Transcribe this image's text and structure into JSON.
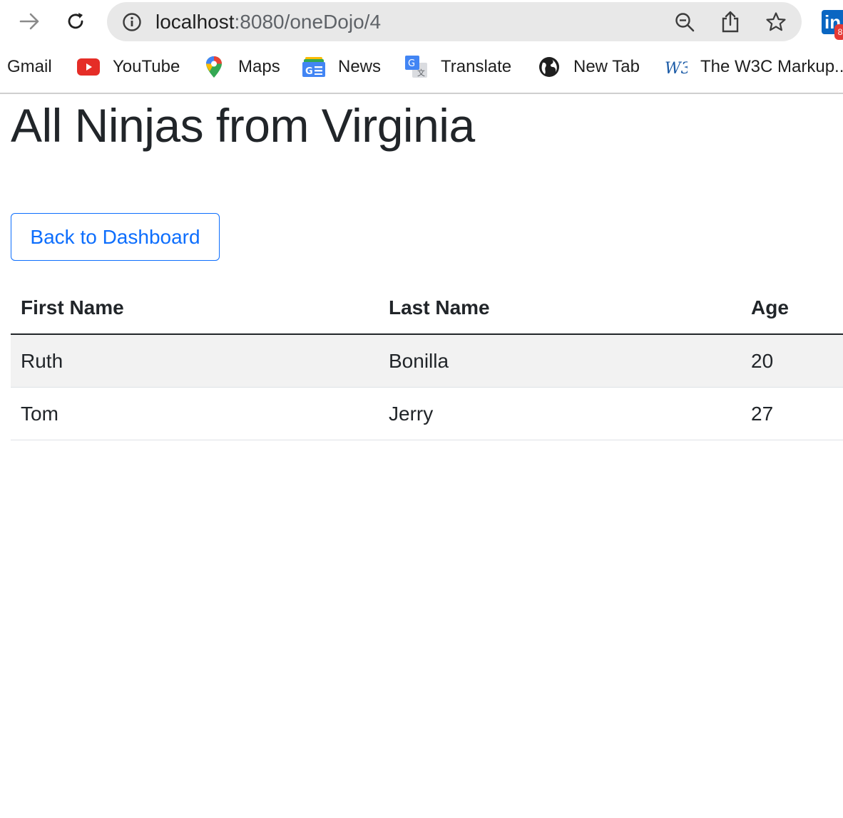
{
  "browser": {
    "url_host": "localhost",
    "url_path": ":8080/oneDojo/4",
    "profile_badge": "in",
    "profile_count": "8"
  },
  "bookmarks": [
    {
      "label": "Gmail",
      "icon": "gmail-icon"
    },
    {
      "label": "YouTube",
      "icon": "youtube-icon"
    },
    {
      "label": "Maps",
      "icon": "maps-icon"
    },
    {
      "label": "News",
      "icon": "news-icon"
    },
    {
      "label": "Translate",
      "icon": "translate-icon"
    },
    {
      "label": "New Tab",
      "icon": "globe-icon"
    },
    {
      "label": "The W3C Markup...",
      "icon": "w3c-icon"
    }
  ],
  "page": {
    "title": "All Ninjas from Virginia",
    "back_button": "Back to Dashboard"
  },
  "table": {
    "headers": [
      "First Name",
      "Last Name",
      "Age"
    ],
    "rows": [
      [
        "Ruth",
        "Bonilla",
        "20"
      ],
      [
        "Tom",
        "Jerry",
        "27"
      ]
    ]
  },
  "colors": {
    "accent": "#0d6efd",
    "text": "#212529",
    "stripe": "#f2f2f2"
  }
}
